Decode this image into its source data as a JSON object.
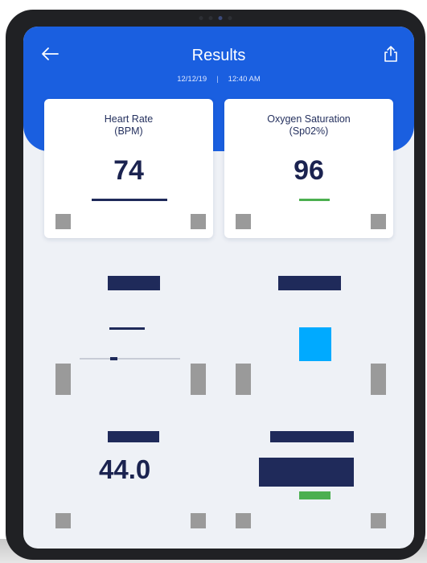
{
  "header": {
    "title": "Results",
    "date": "12/12/19",
    "separator": "|",
    "time": "12:40 AM"
  },
  "cards": {
    "heart_rate": {
      "label_line1": "Heart Rate",
      "label_line2": "(BPM)",
      "value": "74"
    },
    "oxygen": {
      "label_line1": "Oxygen Saturation",
      "label_line2": "(Sp02%)",
      "value": "96"
    },
    "lower_left": {
      "value": "44.0"
    }
  },
  "colors": {
    "brand_blue": "#1a5fe0",
    "navy": "#1f2a5a",
    "green": "#4caf50",
    "cyan": "#00aaff",
    "control_gray": "#9a9a9a"
  },
  "icons": {
    "back": "arrow-left",
    "share": "share-upload"
  }
}
